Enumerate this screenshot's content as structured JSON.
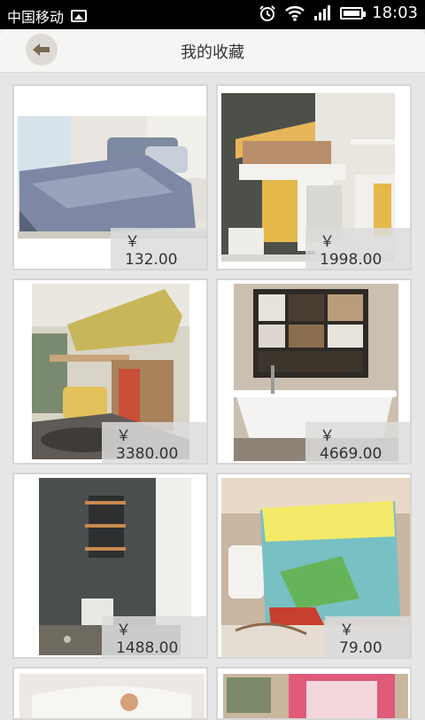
{
  "status_bar": {
    "carrier": "中国移动",
    "time": "18:03"
  },
  "header": {
    "title": "我的收藏"
  },
  "favorites": [
    {
      "price": "￥ 132.00",
      "photo": "bedroom-bed-photo"
    },
    {
      "price": "￥ 1998.00",
      "photo": "loft-bed-desk-photo"
    },
    {
      "price": "￥ 3380.00",
      "photo": "kids-loft-room-photo"
    },
    {
      "price": "￥ 4669.00",
      "photo": "bathtub-shelves-photo"
    },
    {
      "price": "￥ 1488.00",
      "photo": "stone-bathroom-photo"
    },
    {
      "price": "￥ 79.00",
      "photo": "pearl-cushion-photo"
    },
    {
      "price": "",
      "photo": "white-furniture-photo"
    },
    {
      "price": "",
      "photo": "pink-chair-photo"
    }
  ],
  "colors": {
    "accent": "#f5f5f4",
    "price_bg": "#dcdcdc"
  }
}
